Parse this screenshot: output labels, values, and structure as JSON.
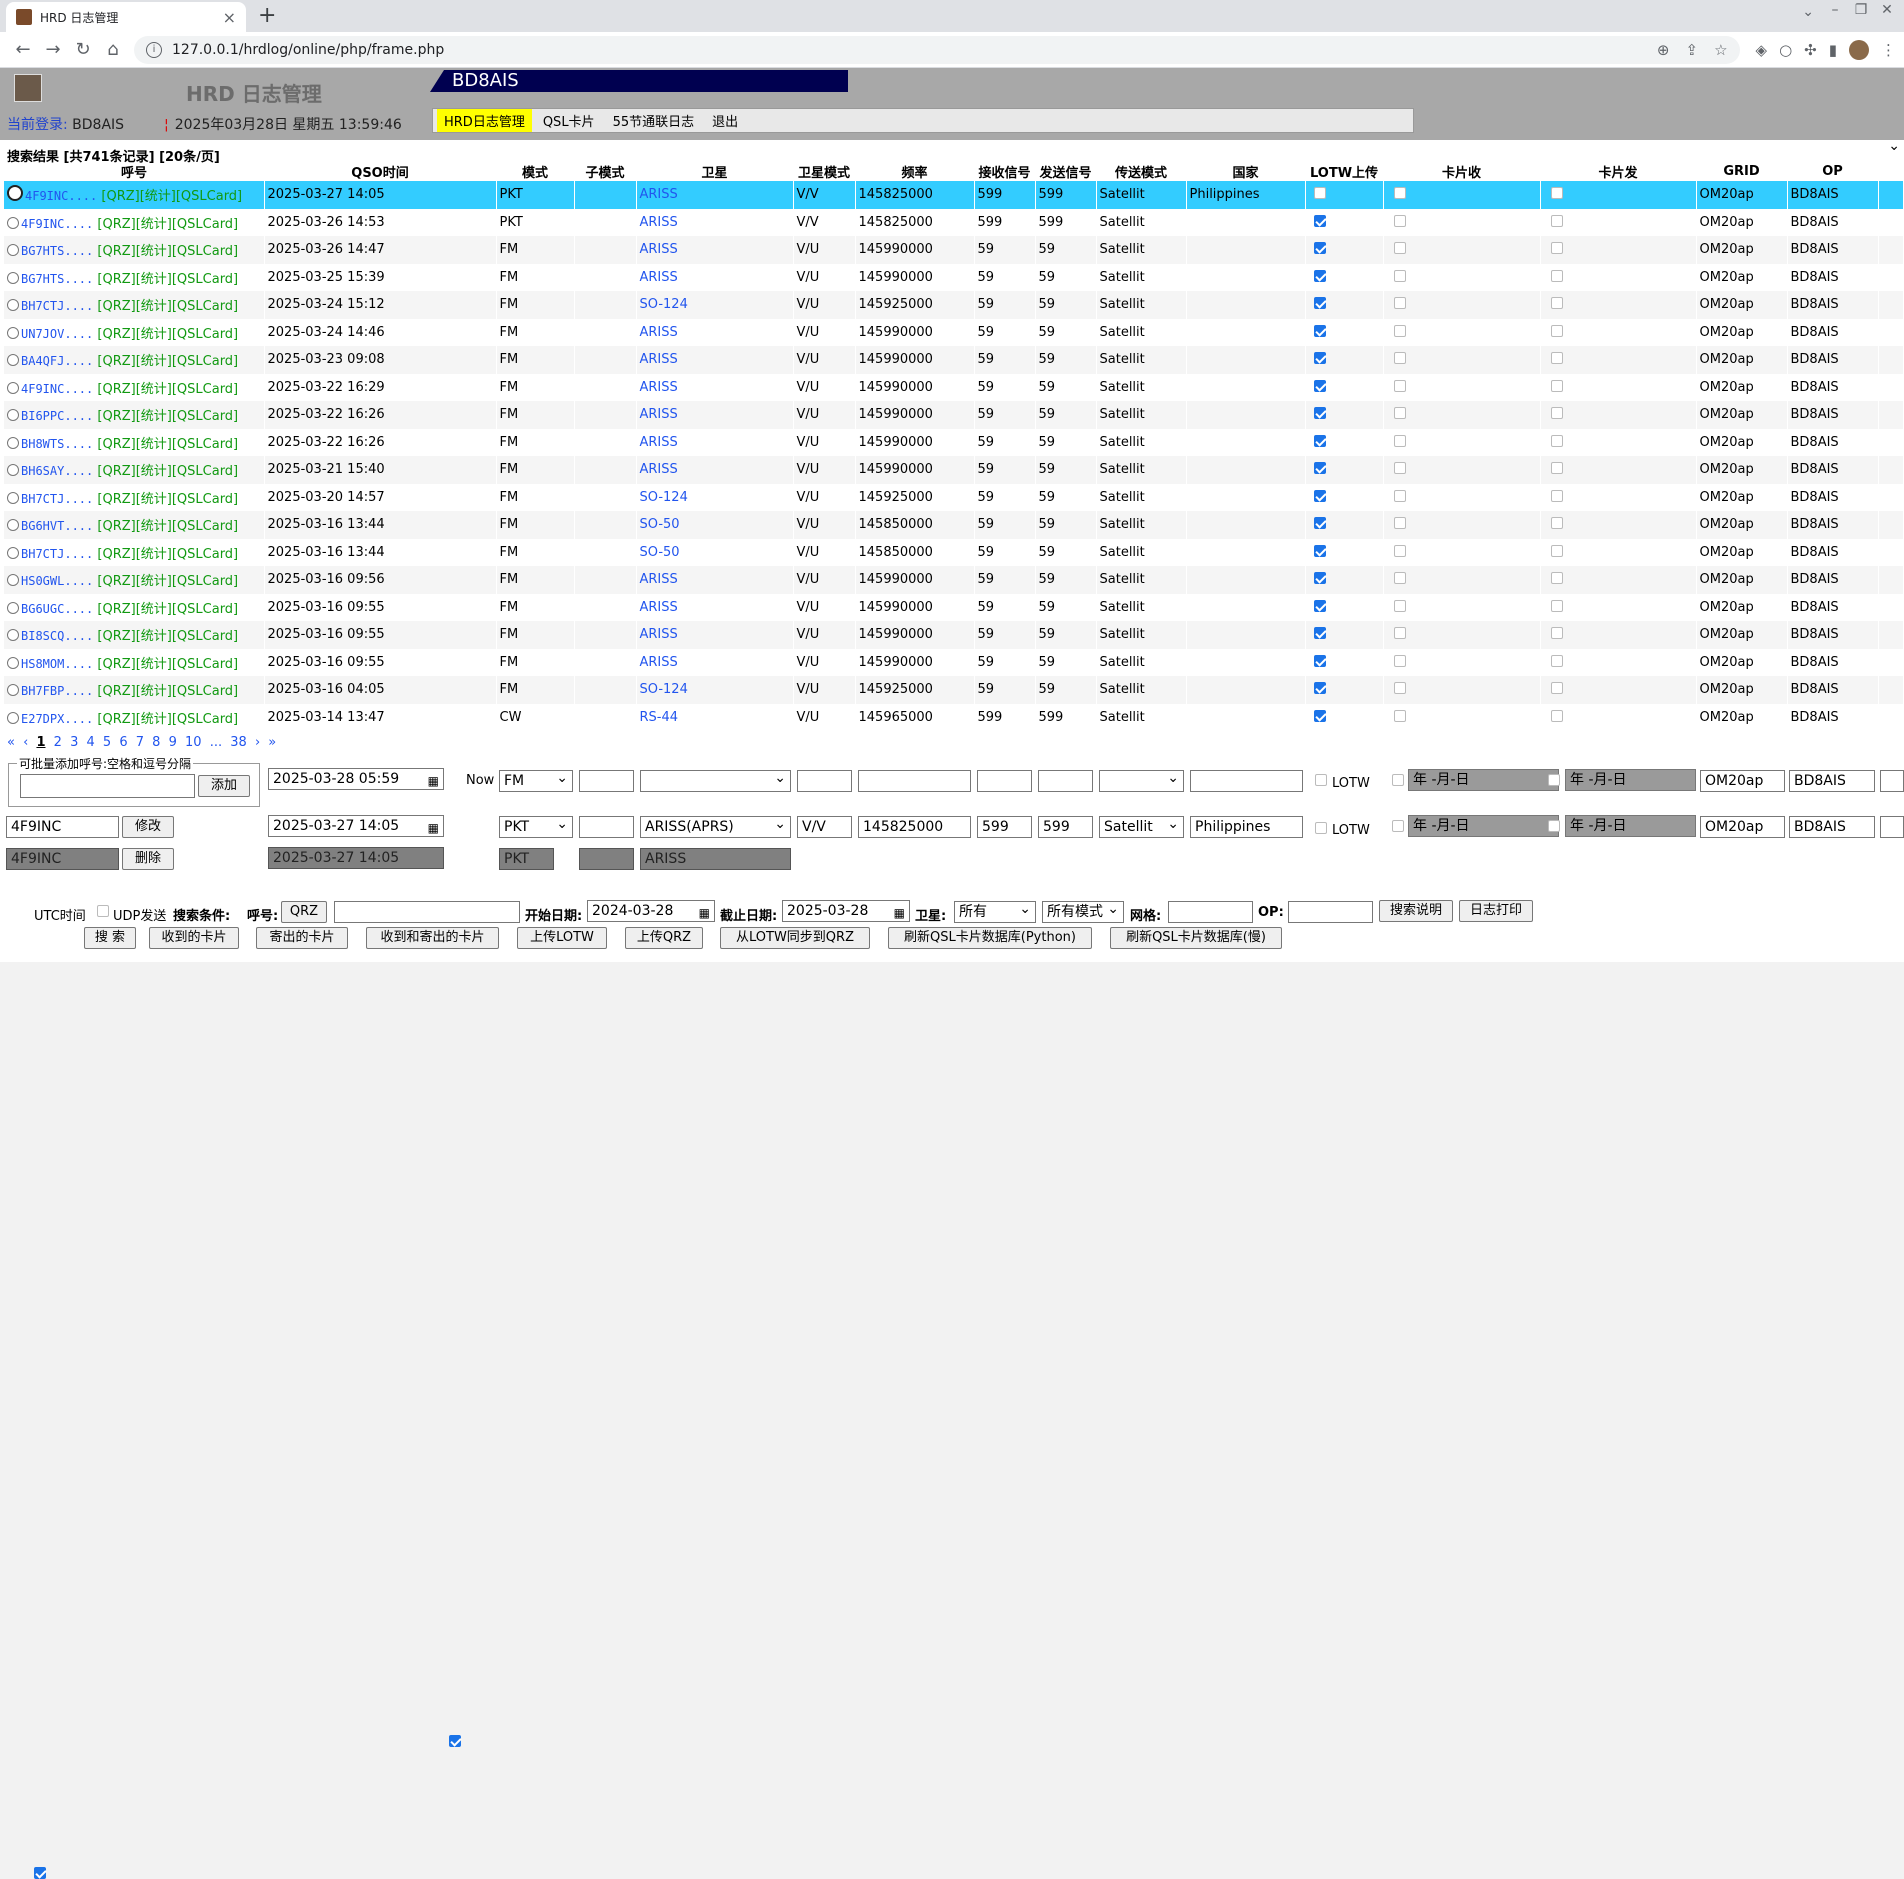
{
  "browser": {
    "tab_title": "HRD 日志管理",
    "url": "127.0.0.1/hrdlog/online/php/frame.php"
  },
  "app": {
    "title": "HRD 日志管理",
    "callsign": "BD8AIS",
    "login_label": "当前登录:",
    "login_user": "BD8AIS",
    "datetime": "2025年03月28日 星期五  13:59:46",
    "menu": [
      "HRD日志管理",
      "QSL卡片",
      "55节通联日志",
      "退出"
    ]
  },
  "results": {
    "info": "搜索结果 [共741条记录] [20条/页]",
    "headers": [
      "呼号",
      "QSO时间",
      "模式",
      "子模式",
      "卫星",
      "卫星模式",
      "频率",
      "接收信号",
      "发送信号",
      "传送模式",
      "国家",
      "LOTW上传",
      "卡片收",
      "卡片发",
      "GRID",
      "OP"
    ],
    "link_tags": "[QRZ][统计][QSLCard]",
    "rows": [
      {
        "call": "4F9INC....",
        "time": "2025-03-27 14:05",
        "mode": "PKT",
        "sat": "ARISS",
        "satmode": "V/V",
        "freq": "145825000",
        "rx": "599",
        "tx": "599",
        "prop": "Satellit",
        "country": "Philippines",
        "lotw": false,
        "grid": "OM20ap",
        "op": "BD8AIS",
        "selected": true
      },
      {
        "call": "4F9INC....",
        "time": "2025-03-26 14:53",
        "mode": "PKT",
        "sat": "ARISS",
        "satmode": "V/V",
        "freq": "145825000",
        "rx": "599",
        "tx": "599",
        "prop": "Satellit",
        "country": "",
        "lotw": true,
        "grid": "OM20ap",
        "op": "BD8AIS"
      },
      {
        "call": "BG7HTS....",
        "time": "2025-03-26 14:47",
        "mode": "FM",
        "sat": "ARISS",
        "satmode": "V/U",
        "freq": "145990000",
        "rx": "59",
        "tx": "59",
        "prop": "Satellit",
        "country": "",
        "lotw": true,
        "grid": "OM20ap",
        "op": "BD8AIS"
      },
      {
        "call": "BG7HTS....",
        "time": "2025-03-25 15:39",
        "mode": "FM",
        "sat": "ARISS",
        "satmode": "V/U",
        "freq": "145990000",
        "rx": "59",
        "tx": "59",
        "prop": "Satellit",
        "country": "",
        "lotw": true,
        "grid": "OM20ap",
        "op": "BD8AIS"
      },
      {
        "call": "BH7CTJ....",
        "time": "2025-03-24 15:12",
        "mode": "FM",
        "sat": "SO-124",
        "satmode": "V/U",
        "freq": "145925000",
        "rx": "59",
        "tx": "59",
        "prop": "Satellit",
        "country": "",
        "lotw": true,
        "grid": "OM20ap",
        "op": "BD8AIS"
      },
      {
        "call": "UN7JOV....",
        "time": "2025-03-24 14:46",
        "mode": "FM",
        "sat": "ARISS",
        "satmode": "V/U",
        "freq": "145990000",
        "rx": "59",
        "tx": "59",
        "prop": "Satellit",
        "country": "",
        "lotw": true,
        "grid": "OM20ap",
        "op": "BD8AIS"
      },
      {
        "call": "BA4QFJ....",
        "time": "2025-03-23 09:08",
        "mode": "FM",
        "sat": "ARISS",
        "satmode": "V/U",
        "freq": "145990000",
        "rx": "59",
        "tx": "59",
        "prop": "Satellit",
        "country": "",
        "lotw": true,
        "grid": "OM20ap",
        "op": "BD8AIS"
      },
      {
        "call": "4F9INC....",
        "time": "2025-03-22 16:29",
        "mode": "FM",
        "sat": "ARISS",
        "satmode": "V/U",
        "freq": "145990000",
        "rx": "59",
        "tx": "59",
        "prop": "Satellit",
        "country": "",
        "lotw": true,
        "grid": "OM20ap",
        "op": "BD8AIS"
      },
      {
        "call": "BI6PPC....",
        "time": "2025-03-22 16:26",
        "mode": "FM",
        "sat": "ARISS",
        "satmode": "V/U",
        "freq": "145990000",
        "rx": "59",
        "tx": "59",
        "prop": "Satellit",
        "country": "",
        "lotw": true,
        "grid": "OM20ap",
        "op": "BD8AIS"
      },
      {
        "call": "BH8WTS....",
        "time": "2025-03-22 16:26",
        "mode": "FM",
        "sat": "ARISS",
        "satmode": "V/U",
        "freq": "145990000",
        "rx": "59",
        "tx": "59",
        "prop": "Satellit",
        "country": "",
        "lotw": true,
        "grid": "OM20ap",
        "op": "BD8AIS"
      },
      {
        "call": "BH6SAY....",
        "time": "2025-03-21 15:40",
        "mode": "FM",
        "sat": "ARISS",
        "satmode": "V/U",
        "freq": "145990000",
        "rx": "59",
        "tx": "59",
        "prop": "Satellit",
        "country": "",
        "lotw": true,
        "grid": "OM20ap",
        "op": "BD8AIS"
      },
      {
        "call": "BH7CTJ....",
        "time": "2025-03-20 14:57",
        "mode": "FM",
        "sat": "SO-124",
        "satmode": "V/U",
        "freq": "145925000",
        "rx": "59",
        "tx": "59",
        "prop": "Satellit",
        "country": "",
        "lotw": true,
        "grid": "OM20ap",
        "op": "BD8AIS"
      },
      {
        "call": "BG6HVT....",
        "time": "2025-03-16 13:44",
        "mode": "FM",
        "sat": "SO-50",
        "satmode": "V/U",
        "freq": "145850000",
        "rx": "59",
        "tx": "59",
        "prop": "Satellit",
        "country": "",
        "lotw": true,
        "grid": "OM20ap",
        "op": "BD8AIS"
      },
      {
        "call": "BH7CTJ....",
        "time": "2025-03-16 13:44",
        "mode": "FM",
        "sat": "SO-50",
        "satmode": "V/U",
        "freq": "145850000",
        "rx": "59",
        "tx": "59",
        "prop": "Satellit",
        "country": "",
        "lotw": true,
        "grid": "OM20ap",
        "op": "BD8AIS"
      },
      {
        "call": "HS0GWL....",
        "time": "2025-03-16 09:56",
        "mode": "FM",
        "sat": "ARISS",
        "satmode": "V/U",
        "freq": "145990000",
        "rx": "59",
        "tx": "59",
        "prop": "Satellit",
        "country": "",
        "lotw": true,
        "grid": "OM20ap",
        "op": "BD8AIS"
      },
      {
        "call": "BG6UGC....",
        "time": "2025-03-16 09:55",
        "mode": "FM",
        "sat": "ARISS",
        "satmode": "V/U",
        "freq": "145990000",
        "rx": "59",
        "tx": "59",
        "prop": "Satellit",
        "country": "",
        "lotw": true,
        "grid": "OM20ap",
        "op": "BD8AIS"
      },
      {
        "call": "BI8SCQ....",
        "time": "2025-03-16 09:55",
        "mode": "FM",
        "sat": "ARISS",
        "satmode": "V/U",
        "freq": "145990000",
        "rx": "59",
        "tx": "59",
        "prop": "Satellit",
        "country": "",
        "lotw": true,
        "grid": "OM20ap",
        "op": "BD8AIS"
      },
      {
        "call": "HS8MOM....",
        "time": "2025-03-16 09:55",
        "mode": "FM",
        "sat": "ARISS",
        "satmode": "V/U",
        "freq": "145990000",
        "rx": "59",
        "tx": "59",
        "prop": "Satellit",
        "country": "",
        "lotw": true,
        "grid": "OM20ap",
        "op": "BD8AIS"
      },
      {
        "call": "BH7FBP....",
        "time": "2025-03-16 04:05",
        "mode": "FM",
        "sat": "SO-124",
        "satmode": "V/U",
        "freq": "145925000",
        "rx": "59",
        "tx": "59",
        "prop": "Satellit",
        "country": "",
        "lotw": true,
        "grid": "OM20ap",
        "op": "BD8AIS"
      },
      {
        "call": "E27DPX....",
        "time": "2025-03-14 13:47",
        "mode": "CW",
        "sat": "RS-44",
        "satmode": "V/U",
        "freq": "145965000",
        "rx": "599",
        "tx": "599",
        "prop": "Satellit",
        "country": "",
        "lotw": true,
        "grid": "OM20ap",
        "op": "BD8AIS"
      }
    ]
  },
  "pager": {
    "first": "«",
    "prev": "‹",
    "pages": [
      "1",
      "2",
      "3",
      "4",
      "5",
      "6",
      "7",
      "8",
      "9",
      "10",
      "...",
      "38"
    ],
    "next": "›",
    "last": "»"
  },
  "editor": {
    "batch_legend": "可批量添加呼号:空格和逗号分隔",
    "add_button": "添加",
    "new_datetime": "2025-03-28 05:59",
    "now_label": "Now",
    "new_mode": "FM",
    "new_prop": "",
    "lotw_label": "LOTW",
    "date_placeholder": "年 -月-日",
    "new_grid": "OM20ap",
    "new_op": "BD8AIS",
    "edit_call": "4F9INC",
    "modify_button": "修改",
    "edit_datetime": "2025-03-27 14:05",
    "edit_mode": "PKT",
    "edit_sat": "ARISS(APRS)",
    "edit_satmode": "V/V",
    "edit_freq": "145825000",
    "edit_rx": "599",
    "edit_tx": "599",
    "edit_prop": "Satellit",
    "edit_country": "Philippines",
    "edit_grid": "OM20ap",
    "edit_op": "BD8AIS",
    "del_call": "4F9INC",
    "delete_button": "删除",
    "del_datetime": "2025-03-27 14:05",
    "del_mode": "PKT",
    "del_sat": "ARISS"
  },
  "search": {
    "utc_label": "UTC时间",
    "udp_label": "UDP发送",
    "criteria_label": "搜索条件:",
    "call_label": "呼号:",
    "qrz_button": "QRZ",
    "start_label": "开始日期:",
    "start_date": "2024-03-28",
    "end_label": "截止日期:",
    "end_date": "2025-03-28",
    "sat_label": "卫星:",
    "sat_value": "所有",
    "mode_value": "所有模式",
    "grid_label": "网格:",
    "op_label": "OP:",
    "help_button": "搜索说明",
    "print_button": "日志打印",
    "buttons": [
      "搜 索",
      "收到的卡片",
      "寄出的卡片",
      "收到和寄出的卡片",
      "上传LOTW",
      "上传QRZ",
      "从LOTW同步到QRZ",
      "刷新QSL卡片数据库(Python)",
      "刷新QSL卡片数据库(慢)"
    ]
  }
}
